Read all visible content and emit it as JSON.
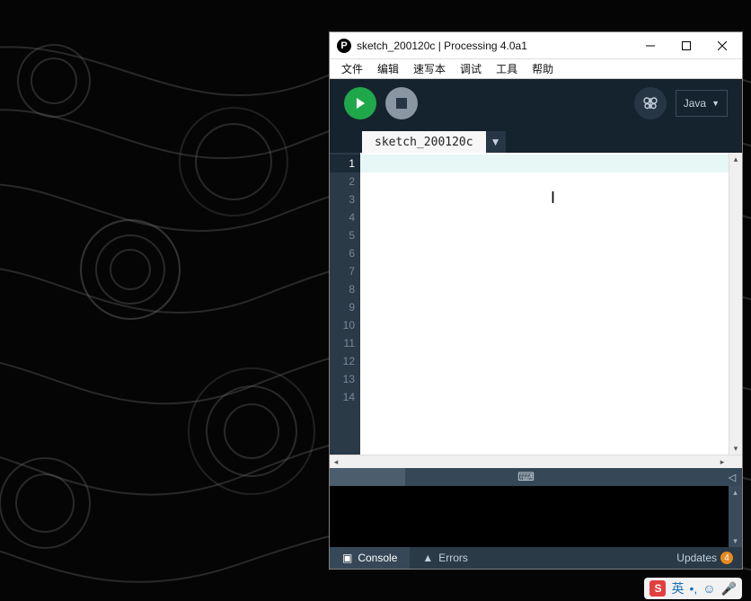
{
  "window": {
    "title": "sketch_200120c | Processing 4.0a1"
  },
  "menu": {
    "file": "文件",
    "edit": "编辑",
    "sketch": "速写本",
    "debug": "调试",
    "tools": "工具",
    "help": "帮助"
  },
  "toolbar": {
    "mode_label": "Java",
    "mode_arrow": "▼"
  },
  "tabs": {
    "active": "sketch_200120c",
    "add_arrow": "▼"
  },
  "gutter": {
    "lines": [
      "1",
      "2",
      "3",
      "4",
      "5",
      "6",
      "7",
      "8",
      "9",
      "10",
      "11",
      "12",
      "13",
      "14"
    ],
    "current": 1
  },
  "footer": {
    "console": "Console",
    "errors": "Errors",
    "updates_label": "Updates",
    "updates_count": "4"
  },
  "ime": {
    "logo": "S",
    "lang": "英",
    "punct": "•,",
    "emoji": "☺",
    "mic": "🎤"
  }
}
